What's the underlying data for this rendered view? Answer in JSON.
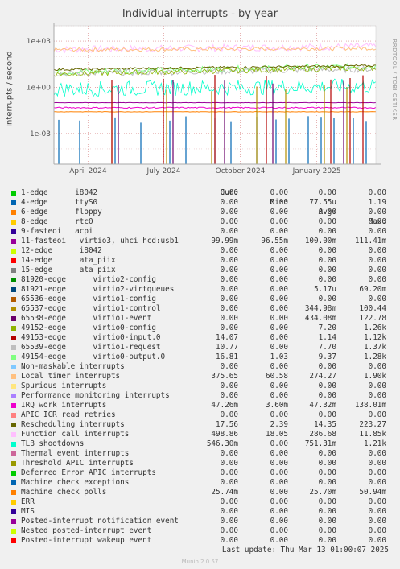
{
  "title": "Individual interrupts - by year",
  "side_label": "RRDTOOL / TOBI OETIKER",
  "footer": "Munin 2.0.57",
  "last_update": "Last update: Thu Mar 13 01:00:07 2025",
  "legend_header": {
    "cur": "Cur:",
    "min": "Min:",
    "avg": "Avg:",
    "max": "Max:"
  },
  "chart_data": {
    "type": "line",
    "title": "Individual interrupts - by year",
    "ylabel": "interrupts / second",
    "yscale": "log",
    "ylim": [
      1e-05,
      10000
    ],
    "yticks": [
      "1e+03",
      "1e+00",
      "1e-03"
    ],
    "yticks_values": [
      1000,
      1,
      0.001
    ],
    "xticks": [
      "April 2024",
      "July 2024",
      "October 2024",
      "January 2025"
    ],
    "xlim": [
      "2024-02-20",
      "2025-03-13"
    ],
    "xticks_dates": [
      "2024-04-01",
      "2024-07-01",
      "2024-10-01",
      "2025-01-01"
    ],
    "grid": true,
    "series": [
      {
        "name": "1-edge      i8042",
        "color": "#00cc00",
        "cur": "0.00",
        "min": "0.00",
        "avg": "0.00",
        "max": "0.00"
      },
      {
        "name": "4-edge      ttyS0",
        "color": "#0066b3",
        "cur": "0.00",
        "min": "0.00",
        "avg": "77.55u",
        "max": "1.19"
      },
      {
        "name": "6-edge      floppy",
        "color": "#ff8000",
        "cur": "0.00",
        "min": "0.00",
        "avg": "0.00",
        "max": "0.00"
      },
      {
        "name": "8-edge      rtc0",
        "color": "#ffcc00",
        "cur": "0.00",
        "min": "0.00",
        "avg": "0.00",
        "max": "0.00"
      },
      {
        "name": "9-fasteoi   acpi",
        "color": "#330099",
        "cur": "0.00",
        "min": "0.00",
        "avg": "0.00",
        "max": "0.00"
      },
      {
        "name": "11-fasteoi   virtio3, uhci_hcd:usb1",
        "color": "#990099",
        "cur": "99.99m",
        "min": "96.55m",
        "avg": "100.00m",
        "max": "111.41m"
      },
      {
        "name": "12-edge      i8042",
        "color": "#ccff00",
        "cur": "0.00",
        "min": "0.00",
        "avg": "0.00",
        "max": "0.00"
      },
      {
        "name": "14-edge      ata_piix",
        "color": "#ff0000",
        "cur": "0.00",
        "min": "0.00",
        "avg": "0.00",
        "max": "0.00"
      },
      {
        "name": "15-edge      ata_piix",
        "color": "#808080",
        "cur": "0.00",
        "min": "0.00",
        "avg": "0.00",
        "max": "0.00"
      },
      {
        "name": "81920-edge      virtio2-config",
        "color": "#008f00",
        "cur": "0.00",
        "min": "0.00",
        "avg": "0.00",
        "max": "0.00"
      },
      {
        "name": "81921-edge      virtio2-virtqueues",
        "color": "#00487d",
        "cur": "0.00",
        "min": "0.00",
        "avg": "5.17u",
        "max": "69.20m"
      },
      {
        "name": "65536-edge      virtio1-config",
        "color": "#b35a00",
        "cur": "0.00",
        "min": "0.00",
        "avg": "0.00",
        "max": "0.00"
      },
      {
        "name": "65537-edge      virtio1-control",
        "color": "#b38f00",
        "cur": "0.00",
        "min": "0.00",
        "avg": "344.98m",
        "max": "100.44"
      },
      {
        "name": "65538-edge      virtio1-event",
        "color": "#6b006b",
        "cur": "0.00",
        "min": "0.00",
        "avg": "434.08m",
        "max": "122.78"
      },
      {
        "name": "49152-edge      virtio0-config",
        "color": "#8fb300",
        "cur": "0.00",
        "min": "0.00",
        "avg": "7.20",
        "max": "1.26k"
      },
      {
        "name": "49153-edge      virtio0-input.0",
        "color": "#b30000",
        "cur": "14.07",
        "min": "0.00",
        "avg": "1.14",
        "max": "1.12k"
      },
      {
        "name": "65539-edge      virtio1-request",
        "color": "#bebebe",
        "cur": "10.77",
        "min": "0.00",
        "avg": "7.70",
        "max": "1.37k"
      },
      {
        "name": "49154-edge      virtio0-output.0",
        "color": "#80ff80",
        "cur": "16.81",
        "min": "1.03",
        "avg": "9.37",
        "max": "1.28k"
      },
      {
        "name": "Non-maskable interrupts",
        "color": "#80c9ff",
        "cur": "0.00",
        "min": "0.00",
        "avg": "0.00",
        "max": "0.00"
      },
      {
        "name": "Local timer interrupts",
        "color": "#ffc080",
        "cur": "375.65",
        "min": "60.58",
        "avg": "274.27",
        "max": "1.90k"
      },
      {
        "name": "Spurious interrupts",
        "color": "#ffe680",
        "cur": "0.00",
        "min": "0.00",
        "avg": "0.00",
        "max": "0.00"
      },
      {
        "name": "Performance monitoring interrupts",
        "color": "#aa80ff",
        "cur": "0.00",
        "min": "0.00",
        "avg": "0.00",
        "max": "0.00"
      },
      {
        "name": "IRQ work interrupts",
        "color": "#ee00cc",
        "cur": "47.26m",
        "min": "3.60m",
        "avg": "47.32m",
        "max": "138.01m"
      },
      {
        "name": "APIC ICR read retries",
        "color": "#ff8080",
        "cur": "0.00",
        "min": "0.00",
        "avg": "0.00",
        "max": "0.00"
      },
      {
        "name": "Rescheduling interrupts",
        "color": "#666600",
        "cur": "17.56",
        "min": "2.39",
        "avg": "14.35",
        "max": "223.27"
      },
      {
        "name": "Function call interrupts",
        "color": "#ffbfff",
        "cur": "498.86",
        "min": "18.05",
        "avg": "286.68",
        "max": "11.85k"
      },
      {
        "name": "TLB shootdowns",
        "color": "#00ffcc",
        "cur": "546.30m",
        "min": "0.00",
        "avg": "751.31m",
        "max": "1.21k"
      },
      {
        "name": "Thermal event interrupts",
        "color": "#cc6699",
        "cur": "0.00",
        "min": "0.00",
        "avg": "0.00",
        "max": "0.00"
      },
      {
        "name": "Threshold APIC interrupts",
        "color": "#999900",
        "cur": "0.00",
        "min": "0.00",
        "avg": "0.00",
        "max": "0.00"
      },
      {
        "name": "Deferred Error APIC interrupts",
        "color": "#00cc00",
        "cur": "0.00",
        "min": "0.00",
        "avg": "0.00",
        "max": "0.00"
      },
      {
        "name": "Machine check exceptions",
        "color": "#0066b3",
        "cur": "0.00",
        "min": "0.00",
        "avg": "0.00",
        "max": "0.00"
      },
      {
        "name": "Machine check polls",
        "color": "#ff8000",
        "cur": "25.74m",
        "min": "0.00",
        "avg": "25.70m",
        "max": "50.94m"
      },
      {
        "name": "ERR",
        "color": "#ffcc00",
        "cur": "0.00",
        "min": "0.00",
        "avg": "0.00",
        "max": "0.00"
      },
      {
        "name": "MIS",
        "color": "#330099",
        "cur": "0.00",
        "min": "0.00",
        "avg": "0.00",
        "max": "0.00"
      },
      {
        "name": "Posted-interrupt notification event",
        "color": "#990099",
        "cur": "0.00",
        "min": "0.00",
        "avg": "0.00",
        "max": "0.00"
      },
      {
        "name": "Nested posted-interrupt event",
        "color": "#ccff00",
        "cur": "0.00",
        "min": "0.00",
        "avg": "0.00",
        "max": "0.00"
      },
      {
        "name": "Posted-interrupt wakeup event",
        "color": "#ff0000",
        "cur": "0.00",
        "min": "0.00",
        "avg": "0.00",
        "max": "0.00"
      }
    ]
  }
}
